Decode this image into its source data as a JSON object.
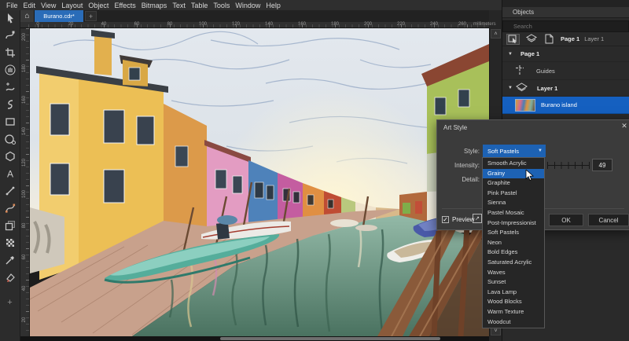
{
  "menu": {
    "items": [
      "File",
      "Edit",
      "View",
      "Layout",
      "Object",
      "Effects",
      "Bitmaps",
      "Text",
      "Table",
      "Tools",
      "Window",
      "Help"
    ]
  },
  "tabbar": {
    "home_icon": "home-icon",
    "active_tab": "Burano.cdr*",
    "new_tab_label": "+"
  },
  "toolbox": {
    "tools": [
      "pick",
      "shape",
      "crop",
      "pan",
      "freehand",
      "artistic-media",
      "rectangle",
      "ellipse",
      "polygon",
      "text",
      "line",
      "bezier",
      "drop-shadow",
      "transparency",
      "eyedropper",
      "fill"
    ],
    "add_label": "+"
  },
  "ruler": {
    "unit_label": "millimeters",
    "h_ticks": [
      "0",
      "20",
      "40",
      "60",
      "80",
      "100",
      "120",
      "140",
      "160",
      "180",
      "200",
      "220",
      "240",
      "260"
    ],
    "v_ticks": [
      "200",
      "180",
      "160",
      "140",
      "120",
      "100",
      "80",
      "60",
      "40",
      "20"
    ]
  },
  "scrollbar": {
    "up_glyph": "˄",
    "down_glyph": "˅"
  },
  "objects_panel": {
    "title": "Objects",
    "search_placeholder": "Search",
    "breadcrumb": {
      "page": "Page 1",
      "layer": "Layer 1"
    },
    "tree": {
      "page": "Page 1",
      "guides": "Guides",
      "layer": "Layer 1",
      "object": "Burano island"
    }
  },
  "dialog": {
    "title": "Art Style",
    "close_glyph": "✕",
    "style_label": "Style:",
    "style_value": "Soft Pastels",
    "intensity_label": "Intensity:",
    "intensity_value": "49",
    "detail_label": "Detail:",
    "preview_label": "Preview",
    "ok_label": "OK",
    "cancel_label": "Cancel",
    "options": [
      "Smooth Acrylic",
      "Grainy",
      "Graphite",
      "Pink Pastel",
      "Sienna",
      "Pastel Mosaic",
      "Post-Impressionist",
      "Soft Pastels",
      "Neon",
      "Bold Edges",
      "Saturated Acrylic",
      "Waves",
      "Sunset",
      "Lava Lamp",
      "Wood Blocks",
      "Warm Texture",
      "Woodcut"
    ],
    "highlighted_option": "Grainy",
    "checkbox_glyph": "✓",
    "popout_glyph": "↗"
  },
  "colors": {
    "accent_blue": "#1d62b4",
    "selection_blue": "#1560c0",
    "dialog_bg": "#3b3b3b",
    "tab_blue": "#2a6cb8"
  }
}
